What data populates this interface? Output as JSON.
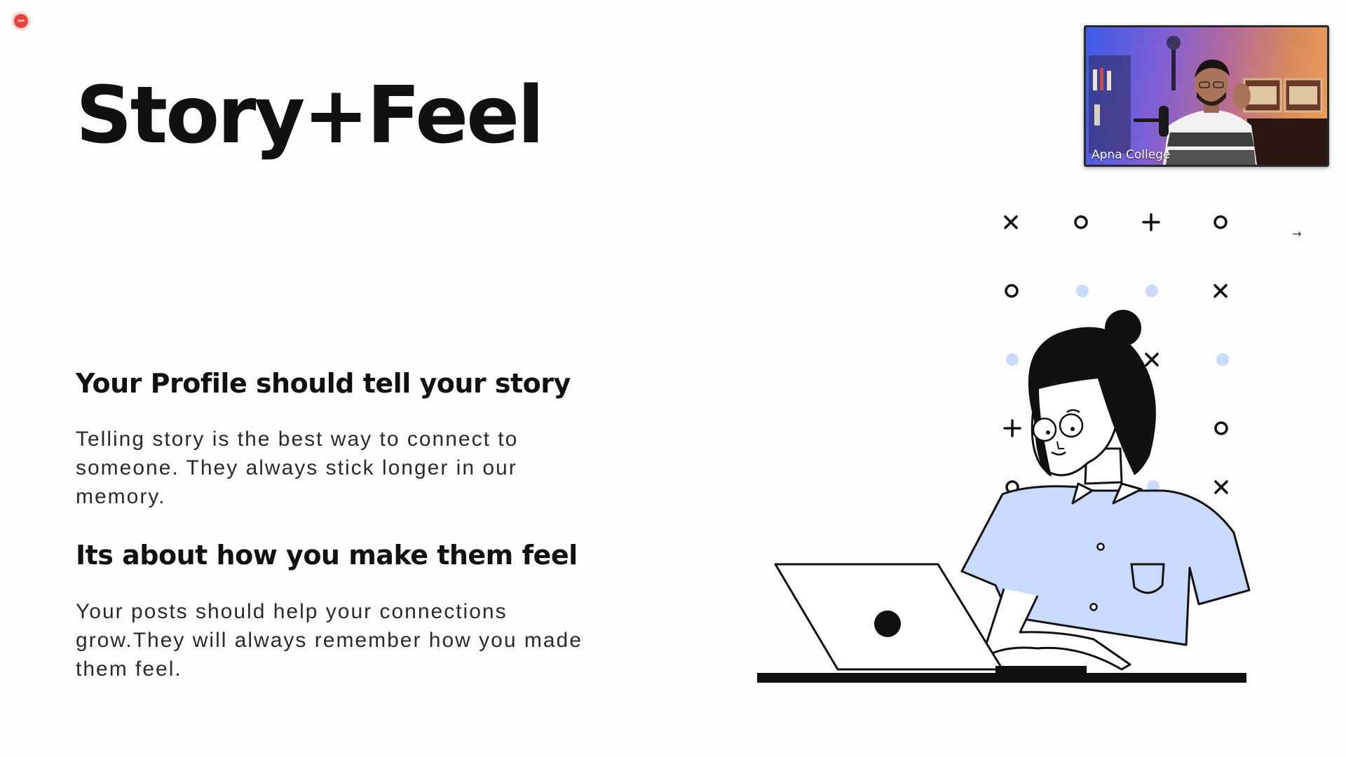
{
  "slide": {
    "title": "Story+Feel",
    "sections": [
      {
        "heading": "Your Profile should tell your story",
        "body": "Telling story is the best way to connect to someone. They always stick longer in our memory."
      },
      {
        "heading": "Its about how you make them feel",
        "body": "Your posts should help your connections grow.They will always remember how you made them feel."
      }
    ]
  },
  "video_feed": {
    "participant_name": "Apna College"
  },
  "illustration": {
    "accent_color": "#c9dafc",
    "ink_color": "#111111"
  },
  "recording_indicator": {
    "color": "#e4453a"
  }
}
